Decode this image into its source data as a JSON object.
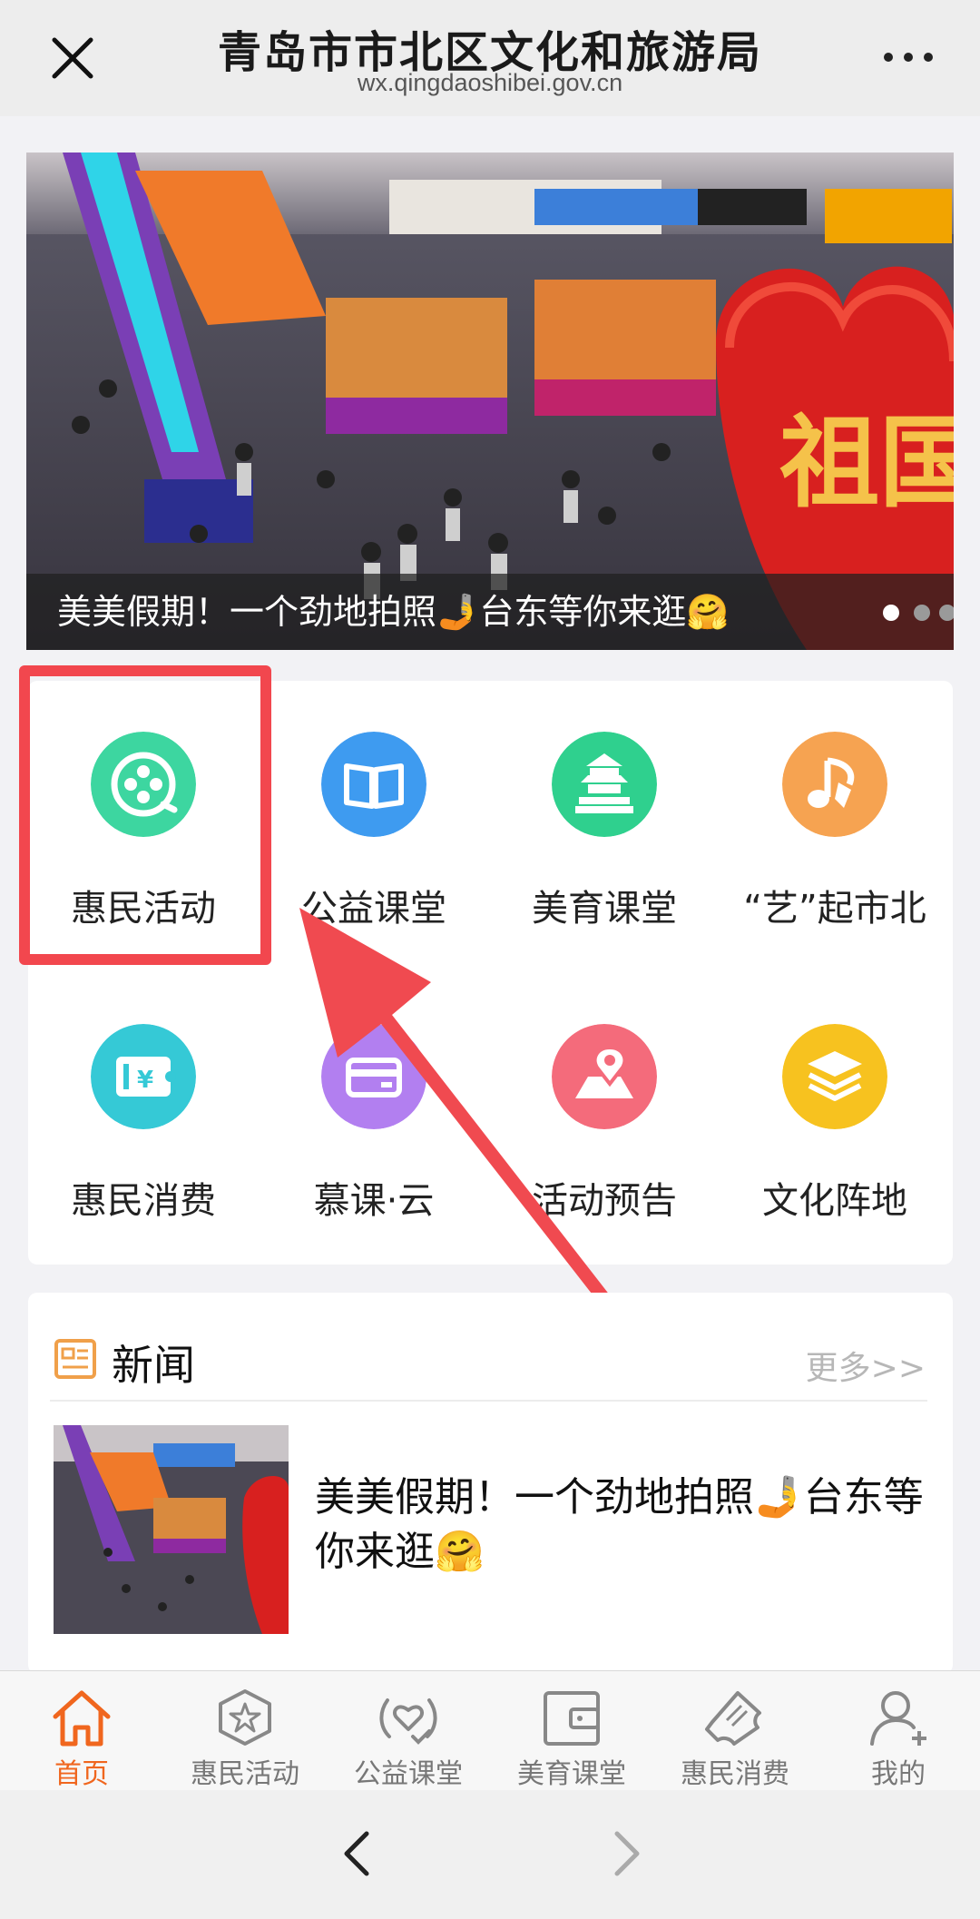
{
  "header": {
    "title": "青岛市市北区文化和旅游局",
    "url": "wx.qingdaoshibei.gov.cn",
    "close_icon": "close-icon",
    "more_icon": "more-icon"
  },
  "banner": {
    "caption": "美美假期！一个劲地拍照🤳台东等你来逛🤗",
    "dots_total": 3,
    "active_dot": 1
  },
  "grid": {
    "items": [
      {
        "label": "惠民活动",
        "icon": "film-reel-icon",
        "color": "#3dd6a0"
      },
      {
        "label": "公益课堂",
        "icon": "book-icon",
        "color": "#3e9bf0"
      },
      {
        "label": "美育课堂",
        "icon": "temple-icon",
        "color": "#2fd08e"
      },
      {
        "label": "“艺”起市北",
        "icon": "music-note-icon",
        "color": "#f6a351"
      },
      {
        "label": "惠民消费",
        "icon": "ticket-icon",
        "color": "#35c9d6"
      },
      {
        "label": "慕课·云",
        "icon": "card-icon",
        "color": "#b27ff0"
      },
      {
        "label": "活动预告",
        "icon": "map-pin-icon",
        "color": "#f46b7b"
      },
      {
        "label": "文化阵地",
        "icon": "layers-icon",
        "color": "#f7c21f"
      }
    ]
  },
  "news": {
    "title": "新闻",
    "more": "更多>>",
    "item": {
      "title": "美美假期！一个劲地拍照🤳台东等你来逛🤗"
    }
  },
  "tabbar": {
    "items": [
      {
        "label": "首页",
        "icon": "home-icon",
        "active": true
      },
      {
        "label": "惠民活动",
        "icon": "star-badge-icon",
        "active": false
      },
      {
        "label": "公益课堂",
        "icon": "heart-signal-icon",
        "active": false
      },
      {
        "label": "美育课堂",
        "icon": "wallet-icon",
        "active": false
      },
      {
        "label": "惠民消费",
        "icon": "ticket-icon",
        "active": false
      },
      {
        "label": "我的",
        "icon": "user-add-icon",
        "active": false
      }
    ]
  },
  "colors": {
    "accent": "#f0661e",
    "highlight": "#f2474e"
  },
  "navigation": {
    "back_icon": "back-icon",
    "forward_icon": "forward-icon"
  }
}
